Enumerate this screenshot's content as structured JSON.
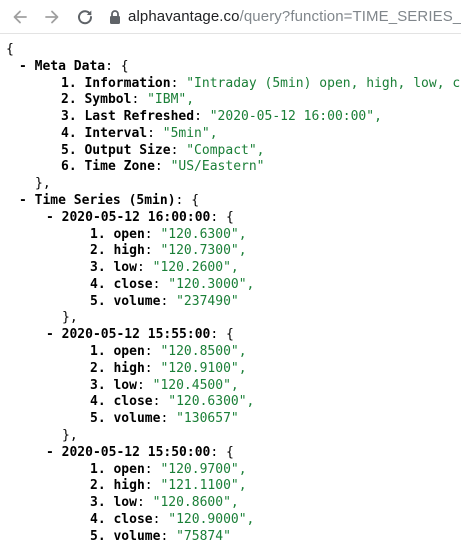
{
  "browser": {
    "url_host": "alphavantage.co",
    "url_path": "/query?function=TIME_SERIES_I"
  },
  "json_view": {
    "open_brace": "{",
    "meta_data": {
      "toggle": "-",
      "key": "Meta Data",
      "open": ": {",
      "close": "},",
      "entries": [
        {
          "key": "1. Information",
          "value": "\"Intraday (5min) open, high, low, c"
        },
        {
          "key": "2. Symbol",
          "value": "\"IBM\","
        },
        {
          "key": "3. Last Refreshed",
          "value": "\"2020-05-12 16:00:00\","
        },
        {
          "key": "4. Interval",
          "value": "\"5min\","
        },
        {
          "key": "5. Output Size",
          "value": "\"Compact\","
        },
        {
          "key": "6. Time Zone",
          "value": "\"US/Eastern\""
        }
      ]
    },
    "time_series": {
      "toggle": "-",
      "key": "Time Series (5min)",
      "open": ": {",
      "bars": [
        {
          "toggle": "-",
          "timestamp": "2020-05-12 16:00:00",
          "open": ": {",
          "close": "},",
          "fields": [
            {
              "key": "1. open",
              "value": "\"120.6300\","
            },
            {
              "key": "2. high",
              "value": "\"120.7300\","
            },
            {
              "key": "3. low",
              "value": "\"120.2600\","
            },
            {
              "key": "4. close",
              "value": "\"120.3000\","
            },
            {
              "key": "5. volume",
              "value": "\"237490\""
            }
          ]
        },
        {
          "toggle": "-",
          "timestamp": "2020-05-12 15:55:00",
          "open": ": {",
          "close": "},",
          "fields": [
            {
              "key": "1. open",
              "value": "\"120.8500\","
            },
            {
              "key": "2. high",
              "value": "\"120.9100\","
            },
            {
              "key": "3. low",
              "value": "\"120.4500\","
            },
            {
              "key": "4. close",
              "value": "\"120.6300\","
            },
            {
              "key": "5. volume",
              "value": "\"130657\""
            }
          ]
        },
        {
          "toggle": "-",
          "timestamp": "2020-05-12 15:50:00",
          "open": ": {",
          "fields": [
            {
              "key": "1. open",
              "value": "\"120.9700\","
            },
            {
              "key": "2. high",
              "value": "\"121.1100\","
            },
            {
              "key": "3. low",
              "value": "\"120.8600\","
            },
            {
              "key": "4. close",
              "value": "\"120.9000\","
            },
            {
              "key": "5. volume",
              "value": "\"75874\""
            }
          ]
        }
      ]
    },
    "colors": {
      "string_value": "#1a7f37",
      "url_host": "#202124",
      "url_path": "#80868b"
    },
    "icons": [
      "back-arrow-icon",
      "forward-arrow-icon",
      "reload-icon",
      "lock-icon"
    ]
  }
}
